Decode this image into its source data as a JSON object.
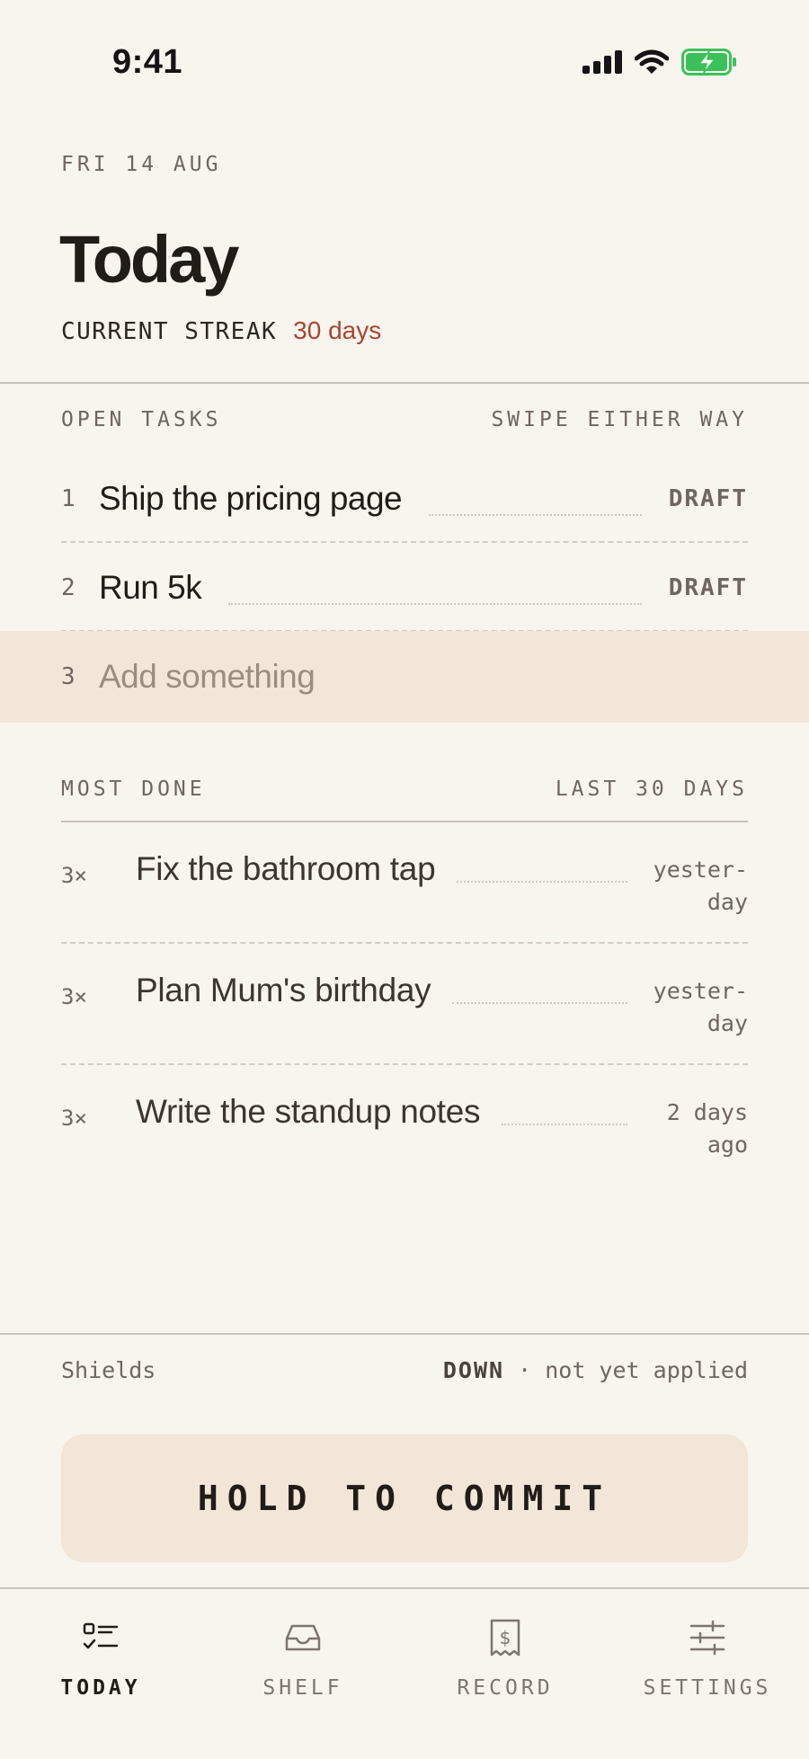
{
  "status_bar": {
    "time": "9:41"
  },
  "header": {
    "date": "FRI 14 AUG",
    "title": "Today",
    "streak_label": "CURRENT STREAK",
    "streak_value": "30 days"
  },
  "open_tasks": {
    "heading": "OPEN TASKS",
    "hint": "SWIPE EITHER WAY",
    "items": [
      {
        "num": "1",
        "text": "Ship the pricing page",
        "badge": "DRAFT"
      },
      {
        "num": "2",
        "text": "Run 5k",
        "badge": "DRAFT"
      }
    ],
    "add_row": {
      "num": "3",
      "placeholder": "Add something"
    }
  },
  "most_done": {
    "heading": "MOST DONE",
    "range": "LAST 30 DAYS",
    "items": [
      {
        "count": "3×",
        "text": "Fix the bathroom tap",
        "when": "yester-\nday"
      },
      {
        "count": "3×",
        "text": "Plan Mum's birthday",
        "when": "yester-\nday"
      },
      {
        "count": "3×",
        "text": "Write the standup notes",
        "when": "2 days\nago"
      }
    ]
  },
  "shields": {
    "label": "Shields",
    "state": "DOWN",
    "note": "· not yet applied"
  },
  "commit_button": "HOLD TO COMMIT",
  "tabs": [
    {
      "label": "TODAY",
      "icon": "checklist-icon",
      "active": true
    },
    {
      "label": "SHELF",
      "icon": "inbox-tray-icon",
      "active": false
    },
    {
      "label": "RECORD",
      "icon": "receipt-dollar-icon",
      "active": false
    },
    {
      "label": "SETTINGS",
      "icon": "sliders-icon",
      "active": false
    }
  ],
  "colors": {
    "background": "#f8f4ee",
    "accent": "#a8452f",
    "highlight": "#f2e6d8",
    "battery": "#3cc15a"
  }
}
